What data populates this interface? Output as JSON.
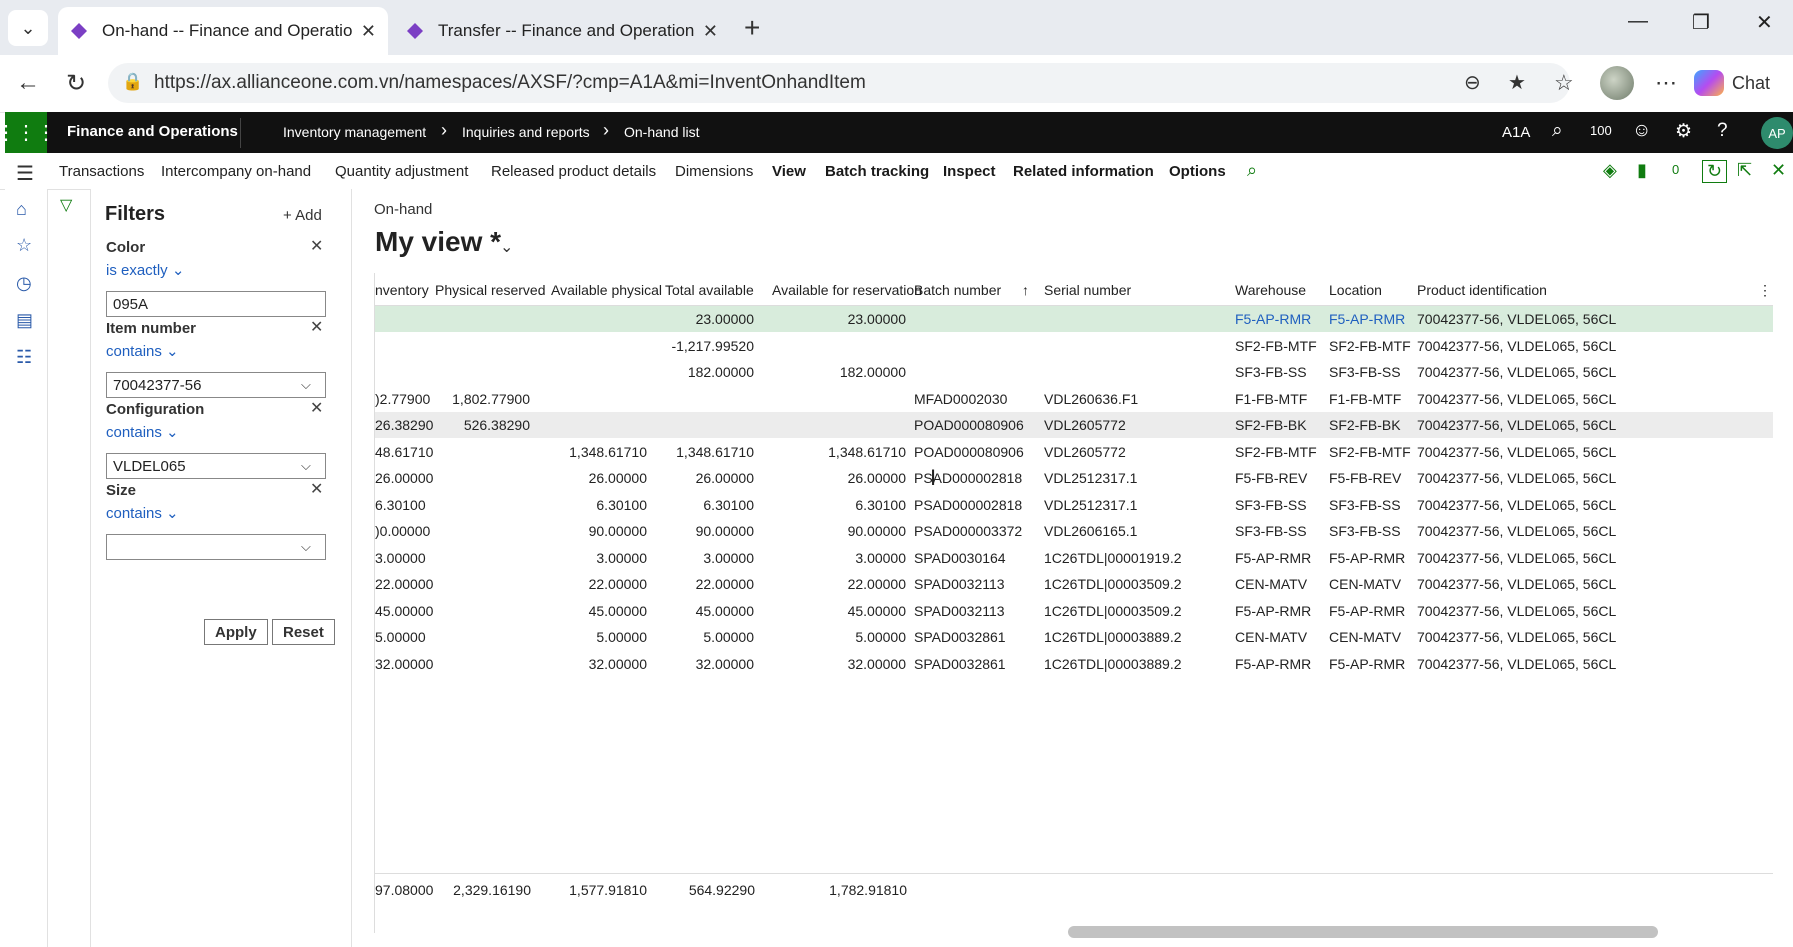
{
  "browser": {
    "tabs": [
      {
        "title": "On-hand -- Finance and Operations",
        "active": true
      },
      {
        "title": "Transfer -- Finance and Operations",
        "active": false
      }
    ],
    "url": "https://ax.allianceone.com.vn/namespaces/AXSF/?cmp=A1A&mi=InventOnhandItem",
    "chat_label": "Chat"
  },
  "app": {
    "name": "Finance and Operations",
    "breadcrumbs": [
      "Inventory management",
      "Inquiries and reports",
      "On-hand list"
    ],
    "company": "A1A",
    "notification_count": "100",
    "user_initials": "AP"
  },
  "actions": [
    "Transactions",
    "Intercompany on-hand",
    "Quantity adjustment",
    "Released product details",
    "Dimensions",
    "View",
    "Batch tracking",
    "Inspect",
    "Related information",
    "Options"
  ],
  "actions_badge": "0",
  "filters": {
    "title": "Filters",
    "add_label": "Add",
    "items": [
      {
        "label": "Color",
        "op": "is exactly",
        "value": "095A"
      },
      {
        "label": "Item number",
        "op": "contains",
        "value": "70042377-56"
      },
      {
        "label": "Configuration",
        "op": "contains",
        "value": "VLDEL065"
      },
      {
        "label": "Size",
        "op": "contains",
        "value": ""
      }
    ],
    "apply_label": "Apply",
    "reset_label": "Reset"
  },
  "main": {
    "subtitle": "On-hand",
    "view_title": "My view *"
  },
  "grid": {
    "columns": [
      "nventory",
      "Physical reserved",
      "Available physical",
      "Total available",
      "Available for reservation",
      "Batch number",
      "Serial number",
      "Warehouse",
      "Location",
      "Product identification"
    ],
    "rows": [
      [
        "",
        "",
        "",
        "23.00000",
        "23.00000",
        "",
        "",
        "F5-AP-RMR",
        "F5-AP-RMR",
        "70042377-56, VLDEL065, 56CL"
      ],
      [
        "",
        "",
        "",
        "-1,217.99520",
        "",
        "",
        "",
        "SF2-FB-MTF",
        "SF2-FB-MTF",
        "70042377-56, VLDEL065, 56CL"
      ],
      [
        "",
        "",
        "",
        "182.00000",
        "182.00000",
        "",
        "",
        "SF3-FB-SS",
        "SF3-FB-SS",
        "70042377-56, VLDEL065, 56CL"
      ],
      [
        ")2.77900",
        "1,802.77900",
        "",
        "",
        "",
        "MFAD0002030",
        "VDL260636.F1",
        "F1-FB-MTF",
        "F1-FB-MTF",
        "70042377-56, VLDEL065, 56CL"
      ],
      [
        "26.38290",
        "526.38290",
        "",
        "",
        "",
        "POAD000080906",
        "VDL2605772",
        "SF2-FB-BK",
        "SF2-FB-BK",
        "70042377-56, VLDEL065, 56CL"
      ],
      [
        "48.61710",
        "",
        "1,348.61710",
        "1,348.61710",
        "1,348.61710",
        "POAD000080906",
        "VDL2605772",
        "SF2-FB-MTF",
        "SF2-FB-MTF",
        "70042377-56, VLDEL065, 56CL"
      ],
      [
        "26.00000",
        "",
        "26.00000",
        "26.00000",
        "26.00000",
        "PSAD000002818",
        "VDL2512317.1",
        "F5-FB-REV",
        "F5-FB-REV",
        "70042377-56, VLDEL065, 56CL"
      ],
      [
        "6.30100",
        "",
        "6.30100",
        "6.30100",
        "6.30100",
        "PSAD000002818",
        "VDL2512317.1",
        "SF3-FB-SS",
        "SF3-FB-SS",
        "70042377-56, VLDEL065, 56CL"
      ],
      [
        ")0.00000",
        "",
        "90.00000",
        "90.00000",
        "90.00000",
        "PSAD000003372",
        "VDL2606165.1",
        "SF3-FB-SS",
        "SF3-FB-SS",
        "70042377-56, VLDEL065, 56CL"
      ],
      [
        "3.00000",
        "",
        "3.00000",
        "3.00000",
        "3.00000",
        "SPAD0030164",
        "1C26TDL|00001919.2",
        "F5-AP-RMR",
        "F5-AP-RMR",
        "70042377-56, VLDEL065, 56CL"
      ],
      [
        "22.00000",
        "",
        "22.00000",
        "22.00000",
        "22.00000",
        "SPAD0032113",
        "1C26TDL|00003509.2",
        "CEN-MATV",
        "CEN-MATV",
        "70042377-56, VLDEL065, 56CL"
      ],
      [
        "45.00000",
        "",
        "45.00000",
        "45.00000",
        "45.00000",
        "SPAD0032113",
        "1C26TDL|00003509.2",
        "F5-AP-RMR",
        "F5-AP-RMR",
        "70042377-56, VLDEL065, 56CL"
      ],
      [
        "5.00000",
        "",
        "5.00000",
        "5.00000",
        "5.00000",
        "SPAD0032861",
        "1C26TDL|00003889.2",
        "CEN-MATV",
        "CEN-MATV",
        "70042377-56, VLDEL065, 56CL"
      ],
      [
        "32.00000",
        "",
        "32.00000",
        "32.00000",
        "32.00000",
        "SPAD0032861",
        "1C26TDL|00003889.2",
        "F5-AP-RMR",
        "F5-AP-RMR",
        "70042377-56, VLDEL065, 56CL"
      ]
    ],
    "totals": [
      "97.08000",
      "2,329.16190",
      "1,577.91810",
      "564.92290",
      "1,782.91810"
    ]
  },
  "colors": {
    "brand_green": "#107c10",
    "link_blue": "#1f5fbf",
    "selected_row": "#d8ecdc"
  }
}
